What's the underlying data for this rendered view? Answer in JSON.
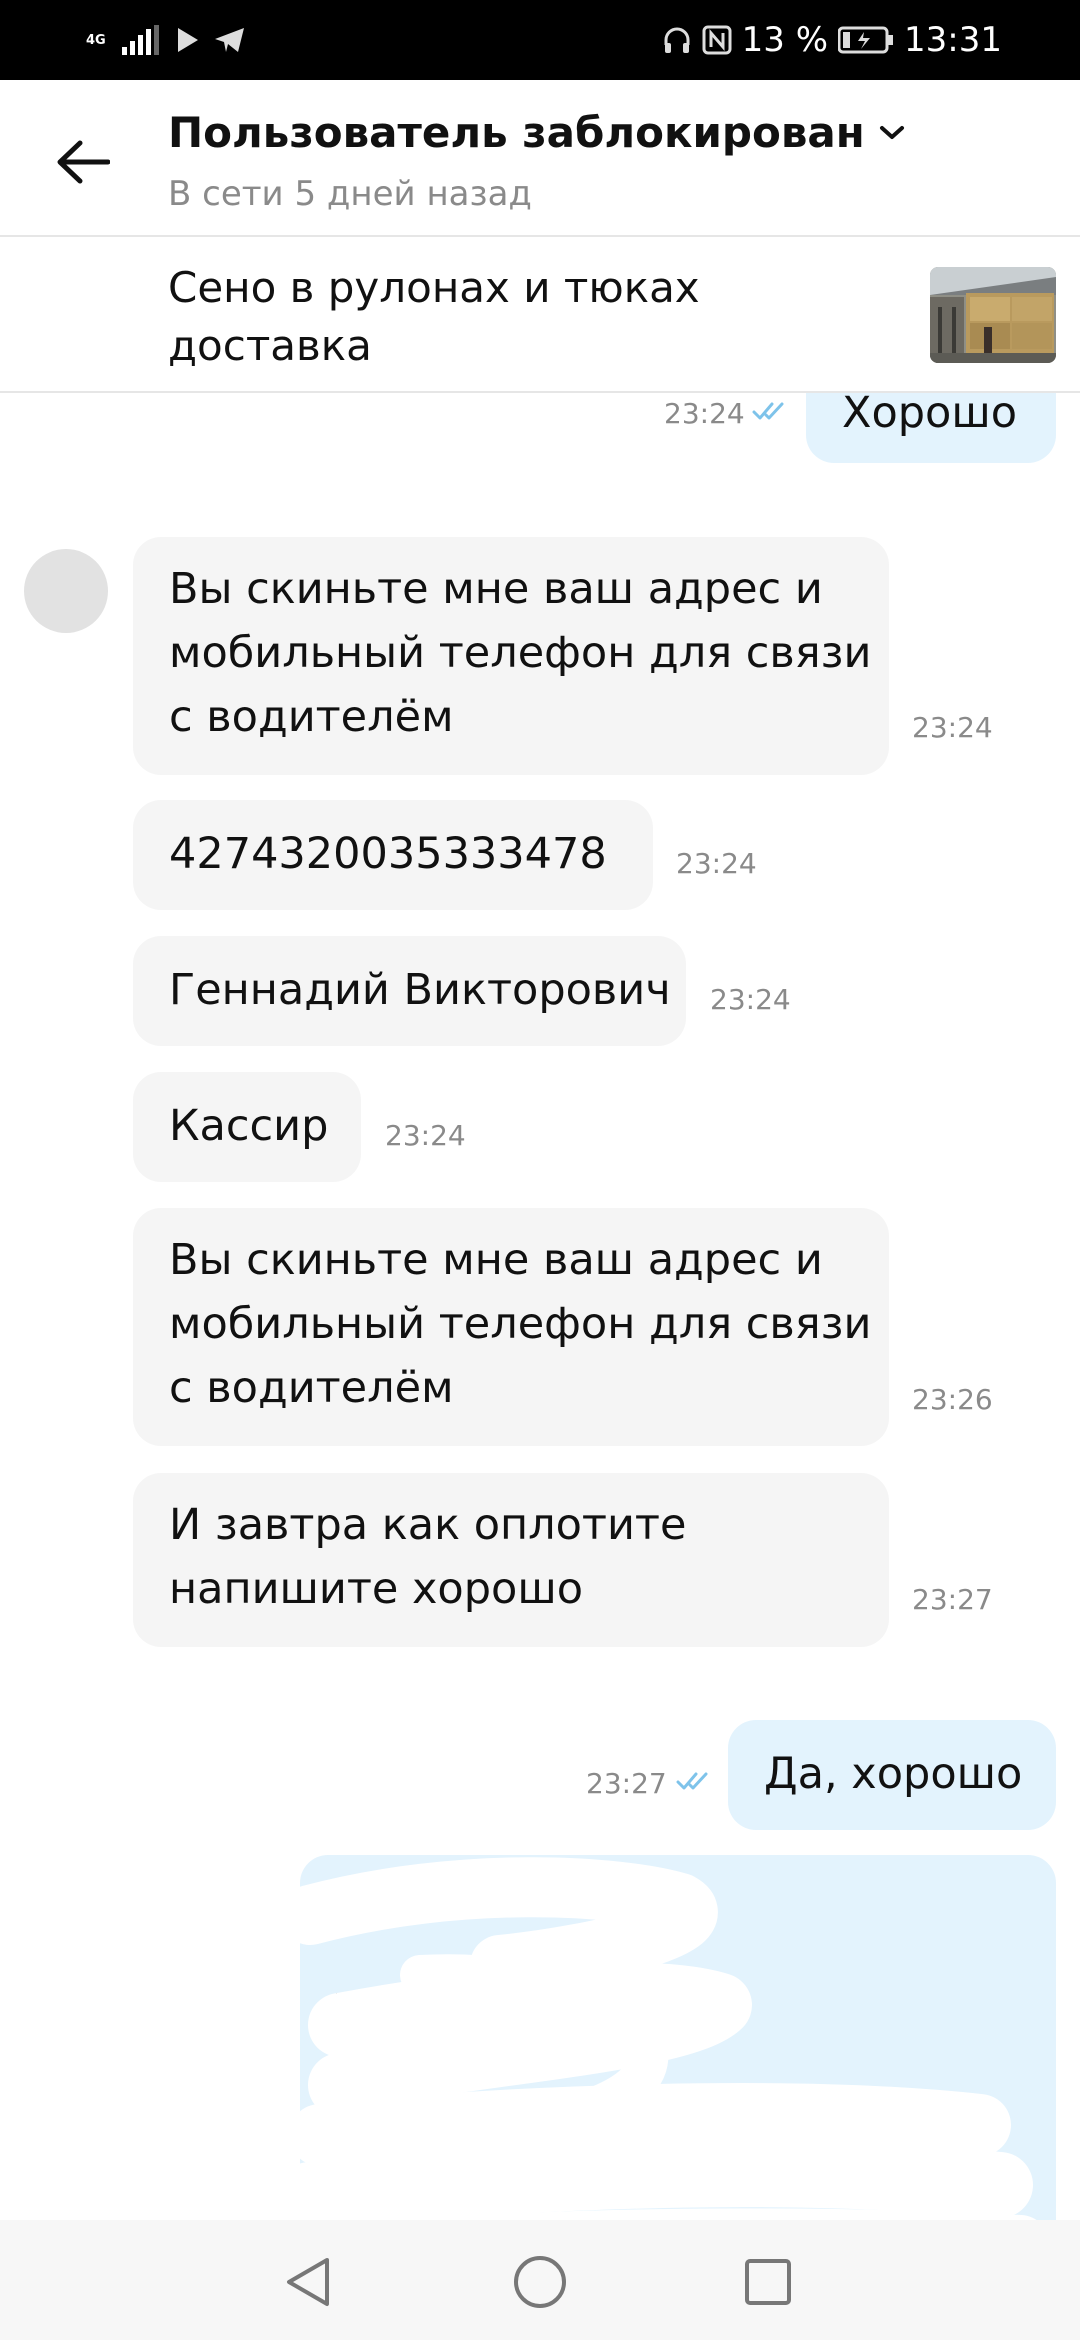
{
  "status_bar": {
    "network": "4G",
    "battery_percent": "13 %",
    "time": "13:31"
  },
  "header": {
    "title": "Пользователь заблокирован",
    "subtitle": "В сети 5 дней назад"
  },
  "item": {
    "title": "Сено в рулонах и тюках\nдоставка"
  },
  "messages": [
    {
      "side": "out",
      "text": "Хорошо",
      "time": "23:24",
      "read": true
    },
    {
      "side": "in",
      "text": "Вы скиньте мне ваш адрес и\nмобильный телефон для связи\nс водителём",
      "time": "23:24"
    },
    {
      "side": "in",
      "text": "4274320035333478",
      "time": "23:24"
    },
    {
      "side": "in",
      "text": "Геннадий Викторович",
      "time": "23:24"
    },
    {
      "side": "in",
      "text": "Кассир",
      "time": "23:24"
    },
    {
      "side": "in",
      "text": "Вы скиньте мне ваш адрес и\nмобильный телефон для связи\nс водителём",
      "time": "23:26"
    },
    {
      "side": "in",
      "text": "И завтра как оплотите\nнапишите хорошо",
      "time": "23:27"
    },
    {
      "side": "out",
      "text": "Да, хорошо",
      "time": "23:27",
      "read": true
    }
  ],
  "colors": {
    "incoming_bubble": "#f5f5f5",
    "outgoing_bubble": "#e3f3fd",
    "read_ticks": "#7ec3ea",
    "timestamp": "#8a8a8a"
  }
}
